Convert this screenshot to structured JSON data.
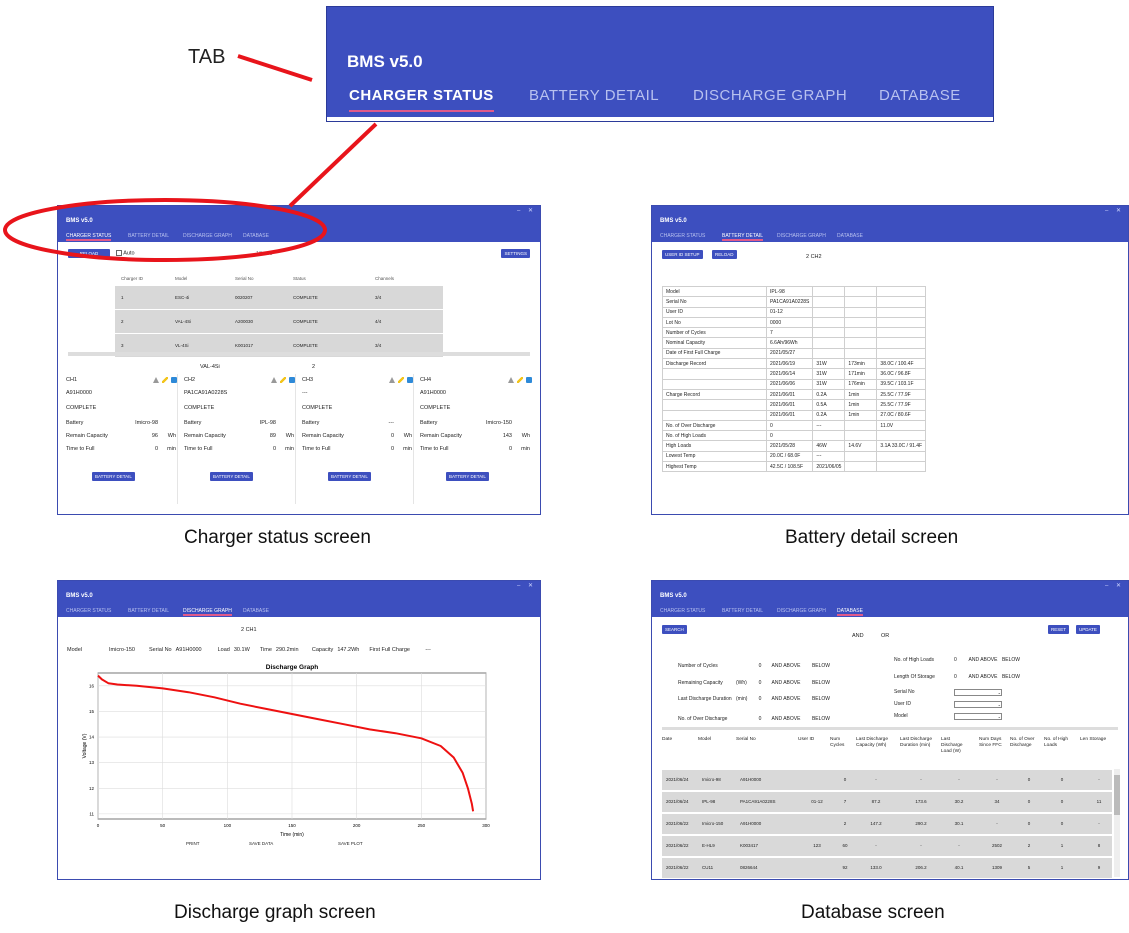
{
  "tab_callout": {
    "label": "TAB",
    "app_title": "BMS v5.0",
    "tabs": [
      "CHARGER STATUS",
      "BATTERY DETAIL",
      "DISCHARGE GRAPH",
      "DATABASE"
    ],
    "active_tab": 0
  },
  "colors": {
    "header": "#3d4fbf",
    "active_underline": "#e05a8a",
    "callout": "#e8141b",
    "plot_line": "#ee1111"
  },
  "captions": {
    "charger": "Charger status screen",
    "battery": "Battery detail screen",
    "graph": "Discharge graph screen",
    "database": "Database screen"
  },
  "charger": {
    "app_title": "BMS v5.0",
    "tabs": [
      "CHARGER STATUS",
      "BATTERY DETAIL",
      "DISCHARGE GRAPH",
      "DATABASE"
    ],
    "reload_label": "RELOAD",
    "auto_label": "Auto",
    "interval_label": "10 sec",
    "settings_label": "SETTINGS",
    "table_headers": [
      "Charger ID",
      "Model",
      "Serial No",
      "Status",
      "Channels"
    ],
    "rows": [
      [
        "1",
        "ESC-4i",
        "0020207",
        "COMPLETE",
        "3/4"
      ],
      [
        "2",
        "VAL-4Si",
        "A200030",
        "COMPLETE",
        "4/4"
      ],
      [
        "3",
        "VL-4Si",
        "K001017",
        "COMPLETE",
        "3/4"
      ]
    ],
    "selected_model": "VAL-4Si",
    "selected_id": "2",
    "channels": [
      {
        "name": "CH1",
        "serial": "A91H0000",
        "status": "COMPLETE",
        "battery": "Imicro-98",
        "capacity": "96",
        "time": "0"
      },
      {
        "name": "CH2",
        "serial": "PA1CA91A0228S",
        "status": "COMPLETE",
        "battery": "IPL-98",
        "capacity": "89",
        "time": "0"
      },
      {
        "name": "CH3",
        "serial": "---",
        "status": "COMPLETE",
        "battery": "---",
        "capacity": "0",
        "time": "0"
      },
      {
        "name": "CH4",
        "serial": "A91H0000",
        "status": "COMPLETE",
        "battery": "Imicro-150",
        "capacity": "143",
        "time": "0"
      }
    ],
    "labels": {
      "battery": "Battery",
      "remain": "Remain Capacity",
      "time": "Time to Full",
      "wh": "Wh",
      "min": "min",
      "detail_button": "BATTERY DETAIL"
    }
  },
  "battery": {
    "app_title": "BMS v5.0",
    "tabs": [
      "CHARGER STATUS",
      "BATTERY DETAIL",
      "DISCHARGE GRAPH",
      "DATABASE"
    ],
    "buttons": [
      "USER ID SETUP",
      "RELOAD"
    ],
    "channel_label": "2  CH2",
    "rows": [
      [
        "Model",
        "IPL-98",
        "",
        "",
        ""
      ],
      [
        "Serial No",
        "PA1CA91A0228S",
        "",
        "",
        ""
      ],
      [
        "User ID",
        "01-12",
        "",
        "",
        ""
      ],
      [
        "Lot No",
        "0000",
        "",
        "",
        ""
      ],
      [
        "Number of Cycles",
        "7",
        "",
        "",
        ""
      ],
      [
        "Nominal Capacity",
        "6.6Ah/96Wh",
        "",
        "",
        ""
      ],
      [
        "Date of First Full Charge",
        "2021/05/27",
        "",
        "",
        ""
      ],
      [
        "Discharge Record",
        "2021/06/19",
        "31W",
        "173min",
        "38.0C / 100.4F"
      ],
      [
        "",
        "2021/06/14",
        "31W",
        "171min",
        "36.0C / 96.8F"
      ],
      [
        "",
        "2021/06/06",
        "31W",
        "176min",
        "39.5C / 103.1F"
      ],
      [
        "Charge Record",
        "2021/06/01",
        "0.2A",
        "1min",
        "25.5C / 77.9F"
      ],
      [
        "",
        "2021/06/01",
        "0.5A",
        "1min",
        "25.5C / 77.9F"
      ],
      [
        "",
        "2021/06/01",
        "0.2A",
        "1min",
        "27.0C / 80.6F"
      ],
      [
        "No. of Over Discharge",
        "0",
        "---",
        "",
        "11.0V"
      ],
      [
        "No. of High Loads",
        "0",
        "",
        "",
        ""
      ],
      [
        "High Loads",
        "2021/05/28",
        "46W",
        "14.6V",
        "3.1A  33.0C / 91.4F"
      ],
      [
        "Lowest Temp",
        "20.0C / 68.0F",
        "---",
        "",
        ""
      ],
      [
        "Highest Temp",
        "42.5C / 108.5F",
        "2021/06/05",
        "",
        ""
      ]
    ]
  },
  "graph": {
    "app_title": "BMS v5.0",
    "tabs": [
      "CHARGER STATUS",
      "BATTERY DETAIL",
      "DISCHARGE GRAPH",
      "DATABASE"
    ],
    "channel_label": "2  CH1",
    "info": [
      {
        "label": "Model",
        "value": "Imicro-150"
      },
      {
        "label": "Serial No",
        "value": "A91H0000"
      },
      {
        "label": "Load",
        "value": "30.1W"
      },
      {
        "label": "Time",
        "value": "290.2min"
      },
      {
        "label": "Capacity",
        "value": "147.2Wh"
      },
      {
        "label": "First Full Charge",
        "value": "---"
      }
    ],
    "buttons": [
      "PRINT",
      "SAVE DATA",
      "SAVE PLOT"
    ]
  },
  "chart_data": {
    "type": "line",
    "title": "Discharge Graph",
    "xlabel": "Time (min)",
    "ylabel": "Voltage (V)",
    "xlim": [
      0,
      300
    ],
    "ylim": [
      10.8,
      16.5
    ],
    "xticks": [
      0,
      50,
      100,
      150,
      200,
      250,
      300
    ],
    "yticks": [
      11,
      12,
      13,
      14,
      15,
      16
    ],
    "grid": true,
    "x": [
      0,
      3,
      8,
      15,
      30,
      50,
      70,
      90,
      110,
      130,
      150,
      170,
      190,
      210,
      230,
      250,
      265,
      275,
      282,
      286,
      289,
      290
    ],
    "y": [
      16.4,
      16.25,
      16.1,
      16.05,
      16.0,
      15.9,
      15.75,
      15.55,
      15.3,
      15.1,
      14.9,
      14.7,
      14.5,
      14.3,
      14.15,
      13.95,
      13.65,
      13.2,
      12.6,
      12.0,
      11.4,
      11.1
    ]
  },
  "database": {
    "app_title": "BMS v5.0",
    "tabs": [
      "CHARGER STATUS",
      "BATTERY DETAIL",
      "DISCHARGE GRAPH",
      "DATABASE"
    ],
    "search_label": "SEARCH",
    "reset_label": "RESET",
    "update_label": "UPDATE",
    "and_label": "AND",
    "or_label": "OR",
    "left_filters": [
      {
        "label": "Number of Cycles",
        "unit": "",
        "value": "0"
      },
      {
        "label": "Remaining Capacity",
        "unit": "(Wh)",
        "value": "0"
      },
      {
        "label": "Last Discharge Duration",
        "unit": "(min)",
        "value": "0"
      },
      {
        "label": "No. of Over Discharge",
        "unit": "",
        "value": "0"
      }
    ],
    "right_filters": [
      {
        "label": "No. of High Loads",
        "value": "0"
      },
      {
        "label": "Length Of Storage",
        "value": "0"
      },
      {
        "label": "Serial No",
        "value": ""
      },
      {
        "label": "User ID",
        "value": ""
      },
      {
        "label": "Model",
        "value": ""
      }
    ],
    "above": "AND ABOVE",
    "below": "BELOW",
    "headers": [
      "Date",
      "Model",
      "Serial No",
      "User ID",
      "Num Cycles",
      "Last Discharge Capacity (Wh)",
      "Last Discharge Duration (min)",
      "Last Discharge Load (W)",
      "Num Days Since FFC",
      "No. of Over Discharge",
      "No. of High Loads",
      "Len Storage"
    ],
    "rows": [
      [
        "2021/06/24",
        "Imicro-98",
        "A91H0000",
        "",
        "0",
        "-",
        "-",
        "-",
        "-",
        "0",
        "0",
        "-"
      ],
      [
        "2021/06/24",
        "IPL-98",
        "PA1CA91A0228S",
        "01-12",
        "7",
        "87.2",
        "173.6",
        "30.2",
        "34",
        "0",
        "0",
        "11"
      ],
      [
        "2021/06/22",
        "Imicro-150",
        "A91H0000",
        "",
        "2",
        "147.2",
        "290.2",
        "30.1",
        "-",
        "0",
        "0",
        "-"
      ],
      [
        "2021/06/22",
        "E-HL9",
        "K003417",
        "123",
        "60",
        "-",
        "-",
        "-",
        "2502",
        "2",
        "1",
        "8"
      ],
      [
        "2021/06/22",
        "CU11",
        "0826644",
        "",
        "92",
        "133.0",
        "206.2",
        "40.1",
        "1309",
        "5",
        "1",
        "9"
      ]
    ]
  }
}
